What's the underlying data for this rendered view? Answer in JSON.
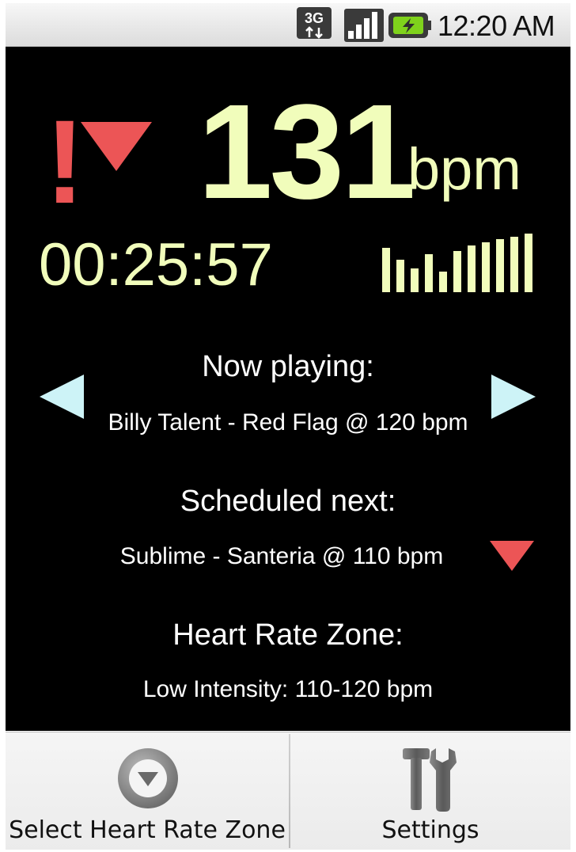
{
  "status_bar": {
    "network_icon": "3g-data-icon",
    "signal_icon": "signal-strength-icon",
    "battery_icon": "battery-charging-icon",
    "time": "12:20 AM"
  },
  "workout": {
    "alert_symbol": "!",
    "alert_direction_icon": "down-arrow-icon",
    "heart_rate_value": "131",
    "heart_rate_unit": "bpm",
    "elapsed_time": "00:25:57",
    "level_meter_icon": "level-meter-icon",
    "level_meter_bars": [
      0.75,
      0.55,
      0.4,
      0.65,
      0.35,
      0.7,
      0.8,
      0.85,
      0.9,
      0.95,
      1.0
    ]
  },
  "now_playing": {
    "heading": "Now playing:",
    "track": "Billy Talent - Red Flag @ 120 bpm",
    "prev_icon": "previous-track-icon",
    "next_icon": "next-track-icon"
  },
  "scheduled_next": {
    "heading": "Scheduled next:",
    "track": "Sublime - Santeria @ 110 bpm",
    "tempo_icon": "tempo-down-icon"
  },
  "zone": {
    "heading": "Heart Rate Zone:",
    "value": "Low Intensity: 110-120 bpm"
  },
  "menu": {
    "items": [
      {
        "label": "Select Heart Rate Zone",
        "icon": "dropdown-circle-icon"
      },
      {
        "label": "Settings",
        "icon": "tools-icon"
      }
    ]
  },
  "colors": {
    "accent_value": "#f1fdbb",
    "alert_red": "#ec5556",
    "nav_arrow": "#cdf3f7",
    "background": "#000000"
  }
}
